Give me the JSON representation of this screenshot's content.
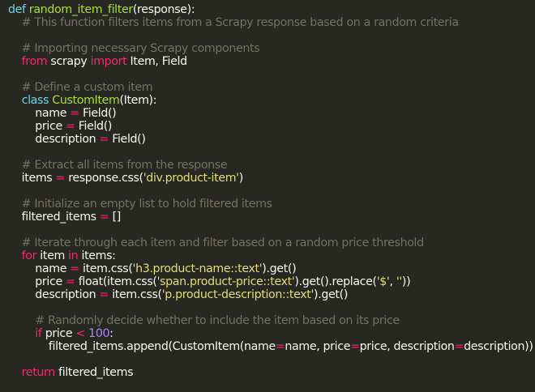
{
  "theme": {
    "background": "#272822",
    "foreground": "#f8f8f2",
    "keyword": "#66d9ef",
    "function": "#a6e22e",
    "comment": "#75715e",
    "string": "#e6db74",
    "operator": "#f92672",
    "number": "#ae81ff"
  },
  "code": {
    "lines": [
      [
        {
          "t": "kw",
          "v": "def"
        },
        {
          "t": "id",
          "v": " "
        },
        {
          "t": "fn",
          "v": "random_item_filter"
        },
        {
          "t": "id",
          "v": "(response):"
        }
      ],
      [
        {
          "t": "cmt",
          "v": "    # This function filters items from a Scrapy response based on a random criteria"
        }
      ],
      [],
      [
        {
          "t": "cmt",
          "v": "    # Importing necessary Scrapy components"
        }
      ],
      [
        {
          "t": "id",
          "v": "    "
        },
        {
          "t": "op",
          "v": "from"
        },
        {
          "t": "id",
          "v": " scrapy "
        },
        {
          "t": "op",
          "v": "import"
        },
        {
          "t": "id",
          "v": " Item, Field"
        }
      ],
      [],
      [
        {
          "t": "cmt",
          "v": "    # Define a custom item"
        }
      ],
      [
        {
          "t": "id",
          "v": "    "
        },
        {
          "t": "kw",
          "v": "class"
        },
        {
          "t": "id",
          "v": " "
        },
        {
          "t": "cls",
          "v": "CustomItem"
        },
        {
          "t": "id",
          "v": "(Item):"
        }
      ],
      [
        {
          "t": "id",
          "v": "        name "
        },
        {
          "t": "op",
          "v": "="
        },
        {
          "t": "id",
          "v": " Field()"
        }
      ],
      [
        {
          "t": "id",
          "v": "        price "
        },
        {
          "t": "op",
          "v": "="
        },
        {
          "t": "id",
          "v": " Field()"
        }
      ],
      [
        {
          "t": "id",
          "v": "        description "
        },
        {
          "t": "op",
          "v": "="
        },
        {
          "t": "id",
          "v": " Field()"
        }
      ],
      [],
      [
        {
          "t": "cmt",
          "v": "    # Extract all items from the response"
        }
      ],
      [
        {
          "t": "id",
          "v": "    items "
        },
        {
          "t": "op",
          "v": "="
        },
        {
          "t": "id",
          "v": " response.css("
        },
        {
          "t": "str",
          "v": "'div.product-item'"
        },
        {
          "t": "id",
          "v": ")"
        }
      ],
      [],
      [
        {
          "t": "cmt",
          "v": "    # Initialize an empty list to hold filtered items"
        }
      ],
      [
        {
          "t": "id",
          "v": "    filtered_items "
        },
        {
          "t": "op",
          "v": "="
        },
        {
          "t": "id",
          "v": " []"
        }
      ],
      [],
      [
        {
          "t": "cmt",
          "v": "    # Iterate through each item and filter based on a random price threshold"
        }
      ],
      [
        {
          "t": "id",
          "v": "    "
        },
        {
          "t": "op",
          "v": "for"
        },
        {
          "t": "id",
          "v": " item "
        },
        {
          "t": "op",
          "v": "in"
        },
        {
          "t": "id",
          "v": " items:"
        }
      ],
      [
        {
          "t": "id",
          "v": "        name "
        },
        {
          "t": "op",
          "v": "="
        },
        {
          "t": "id",
          "v": " item.css("
        },
        {
          "t": "str",
          "v": "'h3.product-name::text'"
        },
        {
          "t": "id",
          "v": ").get()"
        }
      ],
      [
        {
          "t": "id",
          "v": "        price "
        },
        {
          "t": "op",
          "v": "="
        },
        {
          "t": "id",
          "v": " float(item.css("
        },
        {
          "t": "str",
          "v": "'span.product-price::text'"
        },
        {
          "t": "id",
          "v": ").get().replace("
        },
        {
          "t": "str",
          "v": "'$'"
        },
        {
          "t": "id",
          "v": ", "
        },
        {
          "t": "str",
          "v": "''"
        },
        {
          "t": "id",
          "v": "))"
        }
      ],
      [
        {
          "t": "id",
          "v": "        description "
        },
        {
          "t": "op",
          "v": "="
        },
        {
          "t": "id",
          "v": " item.css("
        },
        {
          "t": "str",
          "v": "'p.product-description::text'"
        },
        {
          "t": "id",
          "v": ").get()"
        }
      ],
      [],
      [
        {
          "t": "cmt",
          "v": "        # Randomly decide whether to include the item based on its price"
        }
      ],
      [
        {
          "t": "id",
          "v": "        "
        },
        {
          "t": "op",
          "v": "if"
        },
        {
          "t": "id",
          "v": " price "
        },
        {
          "t": "op",
          "v": "<"
        },
        {
          "t": "id",
          "v": " "
        },
        {
          "t": "num",
          "v": "100"
        },
        {
          "t": "id",
          "v": ":"
        }
      ],
      [
        {
          "t": "id",
          "v": "            filtered_items.append(CustomItem(name"
        },
        {
          "t": "op",
          "v": "="
        },
        {
          "t": "id",
          "v": "name, price"
        },
        {
          "t": "op",
          "v": "="
        },
        {
          "t": "id",
          "v": "price, description"
        },
        {
          "t": "op",
          "v": "="
        },
        {
          "t": "id",
          "v": "description))"
        }
      ],
      [],
      [
        {
          "t": "id",
          "v": "    "
        },
        {
          "t": "op",
          "v": "return"
        },
        {
          "t": "id",
          "v": " filtered_items"
        }
      ]
    ]
  }
}
